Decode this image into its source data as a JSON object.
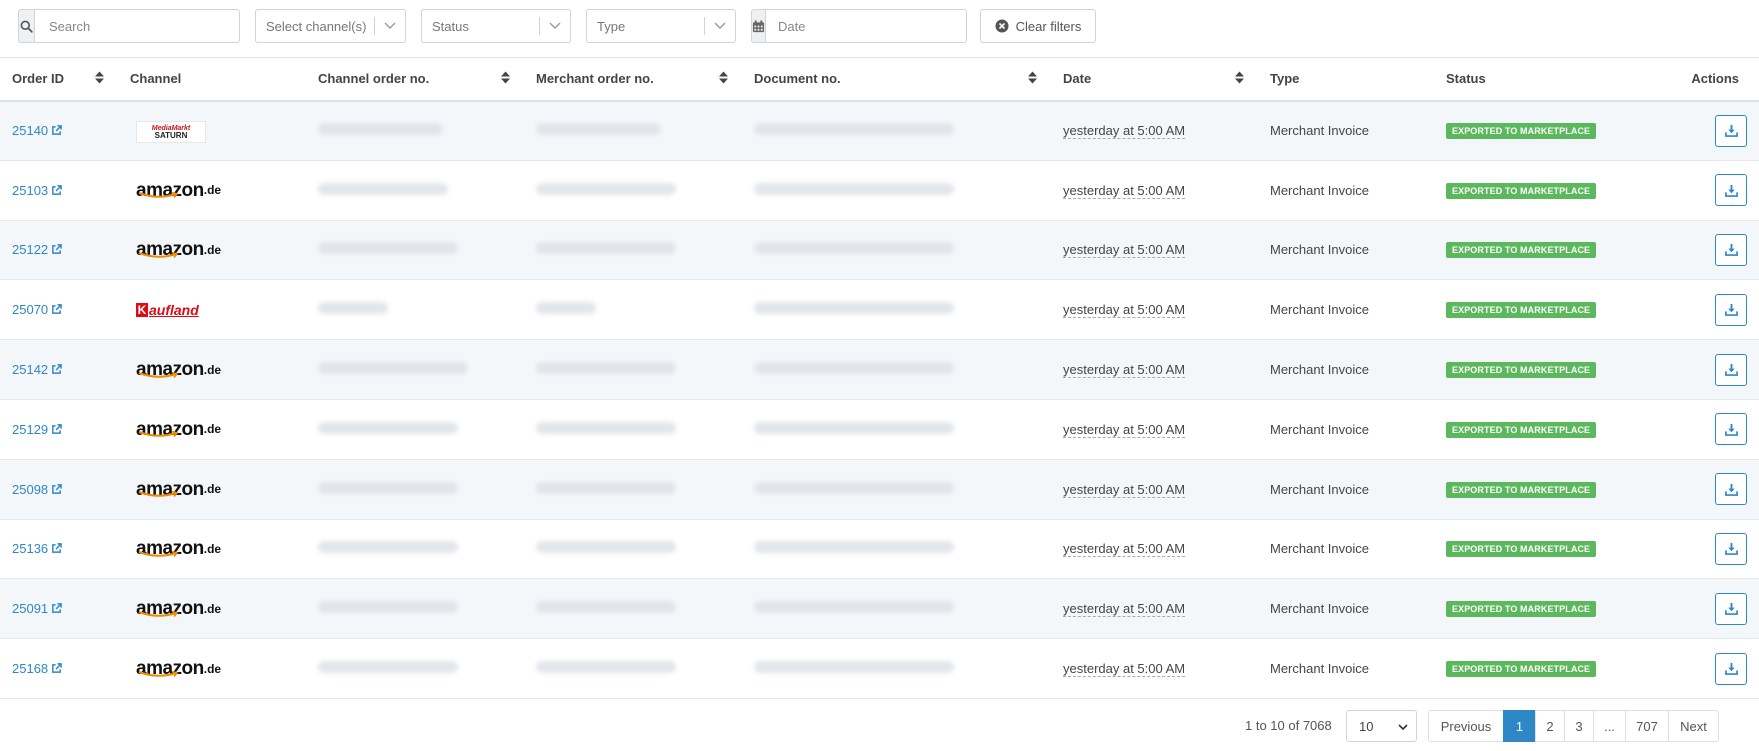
{
  "filters": {
    "search_placeholder": "Search",
    "channel_placeholder": "Select channel(s)",
    "status_placeholder": "Status",
    "type_placeholder": "Type",
    "date_placeholder": "Date",
    "clear_label": "Clear filters"
  },
  "table": {
    "columns": {
      "order_id": "Order ID",
      "channel": "Channel",
      "channel_order_no": "Channel order no.",
      "merchant_order_no": "Merchant order no.",
      "document_no": "Document no.",
      "date": "Date",
      "type": "Type",
      "status": "Status",
      "actions": "Actions"
    },
    "rows": [
      {
        "order_id": "25140",
        "channel": "MediaMarkt Saturn",
        "date": "yesterday at 5:00 AM",
        "type": "Merchant Invoice",
        "status": "EXPORTED TO MARKETPLACE"
      },
      {
        "order_id": "25103",
        "channel": "amazon.de",
        "date": "yesterday at 5:00 AM",
        "type": "Merchant Invoice",
        "status": "EXPORTED TO MARKETPLACE"
      },
      {
        "order_id": "25122",
        "channel": "amazon.de",
        "date": "yesterday at 5:00 AM",
        "type": "Merchant Invoice",
        "status": "EXPORTED TO MARKETPLACE"
      },
      {
        "order_id": "25070",
        "channel": "Kaufland",
        "date": "yesterday at 5:00 AM",
        "type": "Merchant Invoice",
        "status": "EXPORTED TO MARKETPLACE"
      },
      {
        "order_id": "25142",
        "channel": "amazon.de",
        "date": "yesterday at 5:00 AM",
        "type": "Merchant Invoice",
        "status": "EXPORTED TO MARKETPLACE"
      },
      {
        "order_id": "25129",
        "channel": "amazon.de",
        "date": "yesterday at 5:00 AM",
        "type": "Merchant Invoice",
        "status": "EXPORTED TO MARKETPLACE"
      },
      {
        "order_id": "25098",
        "channel": "amazon.de",
        "date": "yesterday at 5:00 AM",
        "type": "Merchant Invoice",
        "status": "EXPORTED TO MARKETPLACE"
      },
      {
        "order_id": "25136",
        "channel": "amazon.de",
        "date": "yesterday at 5:00 AM",
        "type": "Merchant Invoice",
        "status": "EXPORTED TO MARKETPLACE"
      },
      {
        "order_id": "25091",
        "channel": "amazon.de",
        "date": "yesterday at 5:00 AM",
        "type": "Merchant Invoice",
        "status": "EXPORTED TO MARKETPLACE"
      },
      {
        "order_id": "25168",
        "channel": "amazon.de",
        "date": "yesterday at 5:00 AM",
        "type": "Merchant Invoice",
        "status": "EXPORTED TO MARKETPLACE"
      }
    ]
  },
  "pagination": {
    "info": "1 to 10 of 7068",
    "per_page": "10",
    "previous": "Previous",
    "pages": [
      "1",
      "2",
      "3",
      "...",
      "707"
    ],
    "next": "Next",
    "active_page": "1"
  },
  "colors": {
    "link": "#2f88c6",
    "badge": "#5cb85c",
    "stripe": "#f4f7fa"
  }
}
